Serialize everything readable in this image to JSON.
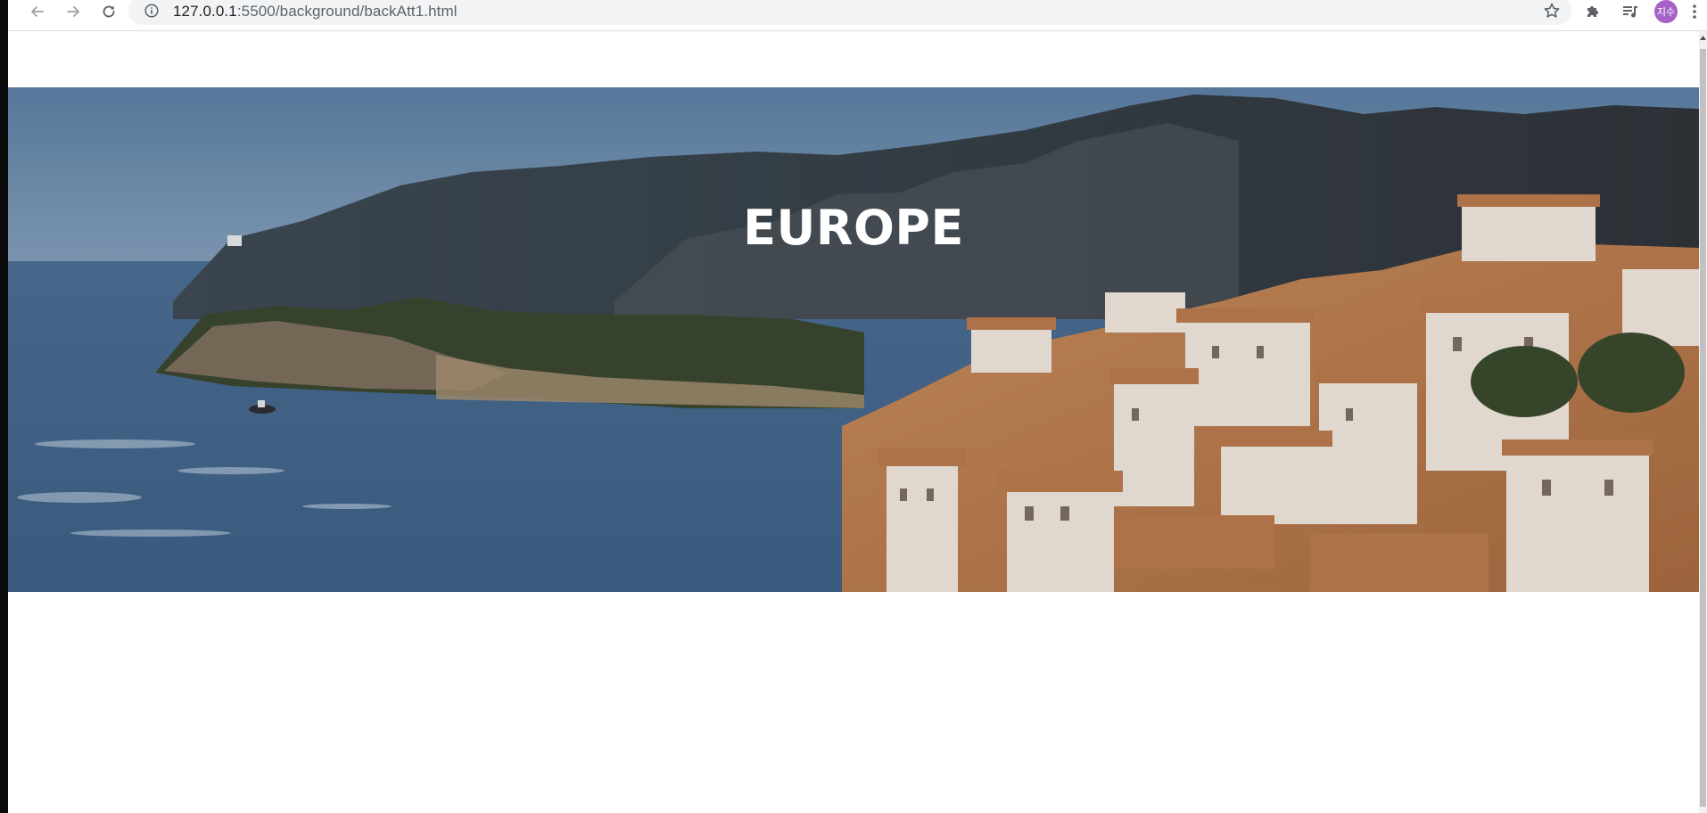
{
  "browser": {
    "url_host": "127.0.0.1",
    "url_path": ":5500/background/backAtt1.html",
    "avatar_text": "지수",
    "icons": {
      "back": "back-arrow-icon",
      "forward": "forward-arrow-icon",
      "reload": "reload-icon",
      "site_info": "info-icon",
      "bookmark": "star-icon",
      "extensions": "puzzle-icon",
      "media": "media-queue-icon",
      "menu": "kebab-menu-icon"
    }
  },
  "hero": {
    "title": "EUROPE",
    "image_description": "coastal-village-landscape"
  },
  "colors": {
    "avatar": "#a762c9",
    "hero_title": "#ffffff"
  }
}
